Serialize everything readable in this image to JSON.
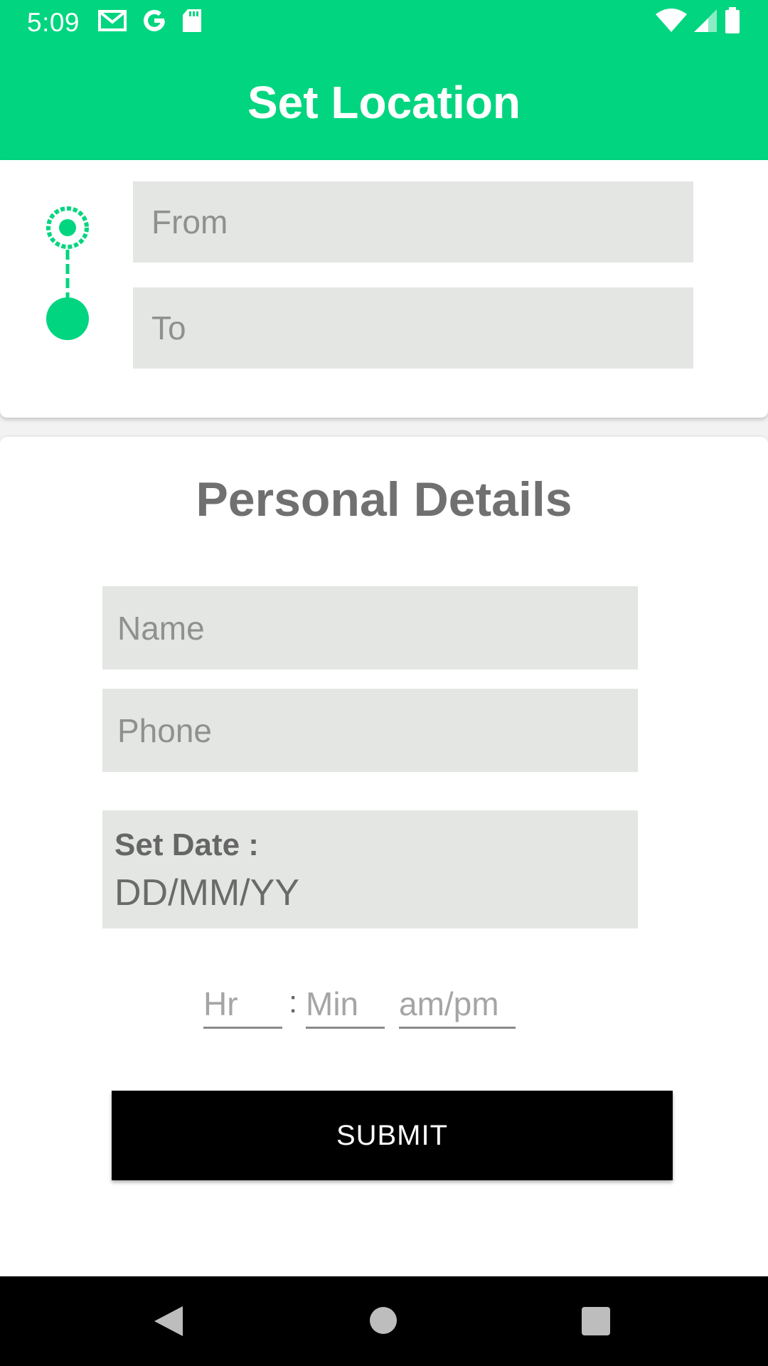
{
  "status_bar": {
    "time": "5:09",
    "left_icons": [
      "gmail-icon",
      "google-icon",
      "sd-card-icon"
    ],
    "right_icons": [
      "wifi-icon",
      "cell-signal-icon",
      "battery-icon"
    ]
  },
  "app_bar": {
    "title": "Set Location"
  },
  "location": {
    "from_placeholder": "From",
    "to_placeholder": "To",
    "accent_color": "#02d57f"
  },
  "details": {
    "title": "Personal Details",
    "name_placeholder": "Name",
    "phone_placeholder": "Phone",
    "date_label": "Set Date :",
    "date_value": "DD/MM/YY",
    "time": {
      "hour_placeholder": "Hr",
      "separator": ":",
      "minute_placeholder": "Min",
      "ampm_placeholder": "am/pm"
    },
    "submit_label": "SUBMIT"
  },
  "nav_bar": {
    "icons": [
      "back-icon",
      "home-icon",
      "recents-icon"
    ]
  }
}
